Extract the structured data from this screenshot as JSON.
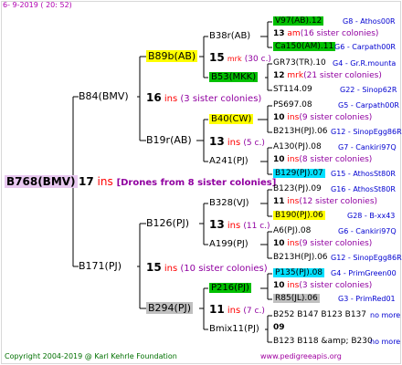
{
  "date": "6-  9-2019 ( 20: 52)",
  "copyright": "Copyright 2004-2019 @ Karl Kehrle Foundation",
  "site": "www.pedigreeapis.org",
  "root": {
    "id": "B768(BMV)",
    "count": "17",
    "ins": "ins",
    "note": "[Drones from 8 sister colonies]"
  },
  "gen1": [
    {
      "id": "B84(BMV)",
      "count": "16",
      "ins": "ins",
      "note": "(3 sister colonies)"
    },
    {
      "id": "B171(PJ)",
      "count": "15",
      "ins": "ins",
      "note": "(10 sister colonies)"
    }
  ],
  "gen2": [
    {
      "id": "B89b(AB)",
      "count": "15",
      "ins": "mrk",
      "note": "(30 c.)"
    },
    {
      "id": "B19r(AB)",
      "count": "13",
      "ins": "ins",
      "note": "(5 c.)"
    },
    {
      "id": "B126(PJ)",
      "count": "13",
      "ins": "ins",
      "note": "(11 c.)"
    },
    {
      "id": "B294(PJ)",
      "count": "11",
      "ins": "ins",
      "note": "(7 c.)"
    }
  ],
  "gen3": [
    {
      "id": "B38r(AB)"
    },
    {
      "id": "B53(MKK)"
    },
    {
      "id": "B40(CW)"
    },
    {
      "id": "A241(PJ)"
    },
    {
      "id": "B328(VJ)"
    },
    {
      "id": "A199(PJ)"
    },
    {
      "id": "P216(PJ)"
    },
    {
      "id": "Bmix11(PJ)"
    }
  ],
  "gen4": [
    {
      "name": "V97(AB).12",
      "info": "G8 - Athos00R"
    },
    {
      "count": "13",
      "ins": "am",
      "note": "(16 sister colonies)"
    },
    {
      "name": "Ca150(AM).11",
      "info": "G6 - Carpath00R"
    },
    {
      "name": "GR73(TR).10",
      "info": "G4 - Gr.R.mounta"
    },
    {
      "count": "12",
      "ins": "mrk",
      "note": "(21 sister colonies)"
    },
    {
      "name": "ST114.09",
      "info": "G22 - Sinop62R"
    },
    {
      "name": "PS697.08",
      "info": "G5 - Carpath00R"
    },
    {
      "count": "10",
      "ins": "ins",
      "note": "(9 sister colonies)"
    },
    {
      "name": "B213H(PJ).06",
      "info": "G12 - SinopEgg86R"
    },
    {
      "name": "A130(PJ).08",
      "info": "G7 - Cankiri97Q"
    },
    {
      "count": "10",
      "ins": "ins",
      "note": "(8 sister colonies)"
    },
    {
      "name": "B129(PJ).07",
      "info": "G15 - AthosSt80R"
    },
    {
      "name": "B123(PJ).09",
      "info": "G16 - AthosSt80R"
    },
    {
      "count": "11",
      "ins": "ins",
      "note": "(12 sister colonies)"
    },
    {
      "name": "B190(PJ).06",
      "info": "G28 - B-xx43"
    },
    {
      "name": "A6(PJ).08",
      "info": "G6 - Cankiri97Q"
    },
    {
      "count": "10",
      "ins": "ins",
      "note": "(9 sister colonies)"
    },
    {
      "name": "B213H(PJ).06",
      "info": "G12 - SinopEgg86R"
    },
    {
      "name": "P135(PJ).08",
      "info": "G4 - PrimGreen00"
    },
    {
      "count": "10",
      "ins": "ins",
      "note": "(3 sister colonies)"
    },
    {
      "name": "R85(JL).06",
      "info": "G3 - PrimRed01"
    },
    {
      "name": "B252 B147 B123 B137",
      "info": "no more"
    },
    {
      "count": "09",
      "ins": "",
      "note": ""
    },
    {
      "name": "B123 B118 &amp; B230",
      "info": "no more"
    }
  ]
}
